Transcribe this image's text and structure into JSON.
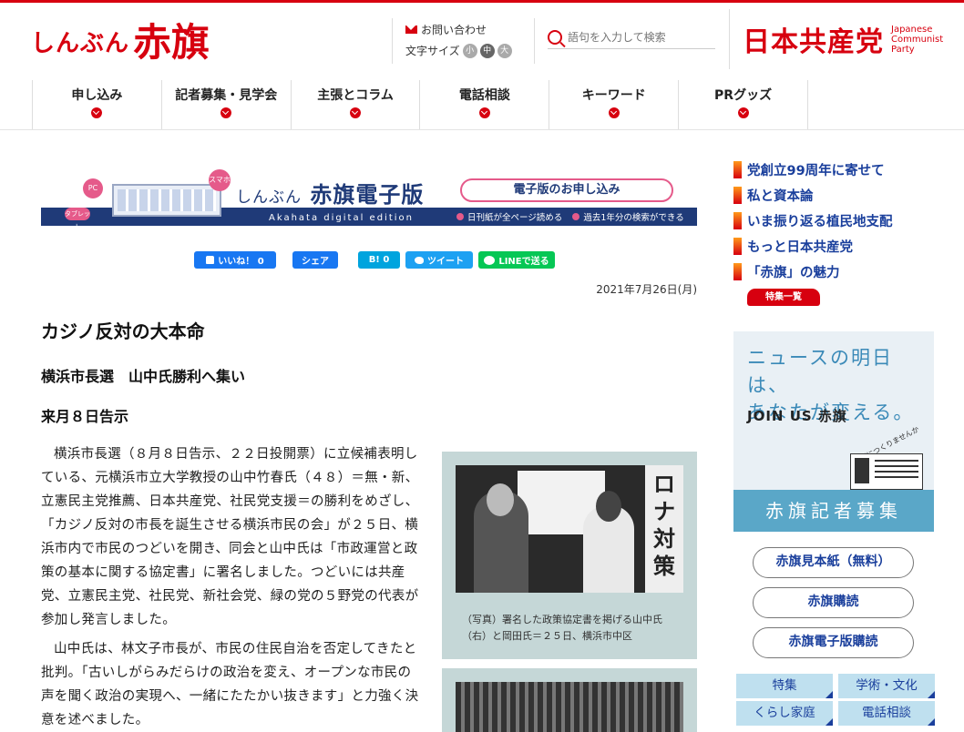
{
  "header": {
    "logo_small": "しんぶん",
    "logo_large": "赤旗",
    "contact_label": "お問い合わせ",
    "font_size_label": "文字サイズ",
    "font_sizes": [
      "小",
      "中",
      "大"
    ],
    "search_placeholder": "語句を入力して検索",
    "party_name": "日本共産党",
    "party_en": [
      "Japanese",
      "Communist",
      "Party"
    ]
  },
  "nav": {
    "items": [
      "申し込み",
      "記者募集・見学会",
      "主張とコラム",
      "電話相談",
      "キーワード",
      "PRグッズ"
    ]
  },
  "banner": {
    "badge_pc": "PC",
    "badge_tablet": "タブレット",
    "badge_sp": "スマホ",
    "title_small": "しんぶん",
    "title_large": "赤旗電子版",
    "subtitle": "Akahata digital edition",
    "apply_label": "電子版のお申し込み",
    "feature1": "日刊紙が全ページ読める",
    "feature2": "過去1年分の検索ができる"
  },
  "share": {
    "fb_label": "いいね！ 0",
    "fb_share": "シェア",
    "hatena_label": "B! 0",
    "tweet_label": "ツイート",
    "line_label": "LINEで送る"
  },
  "article": {
    "date": "2021年7月26日(月)",
    "title": "カジノ反対の大本命",
    "subtitle": "横浜市長選　山中氏勝利へ集い",
    "subtitle2": "来月８日告示",
    "para1": "横浜市長選（８月８日告示、２２日投開票）に立候補表明している、元横浜市立大学教授の山中竹春氏（４８）＝無・新、立憲民主党推薦、日本共産党、社民党支援＝の勝利をめざし、「カジノ反対の市長を誕生させる横浜市民の会」が２５日、横浜市内で市民のつどいを開き、同会と山中氏は「市政運営と政策の基本に関する協定書」に署名しました。つどいには共産党、立憲民主党、社民党、新社会党、緑の党の５野党の代表が参加し発言しました。",
    "para2": "山中氏は、林文子市長が、市民の住民自治を否定してきたと批判。「古いしがらみだらけの政治を変え、オープンな市民の声を聞く政治の実現へ、一緒にたたかい抜きます」と力強く決意を述べました。",
    "photo_sign": "ロナ対策",
    "caption": "（写真）署名した政策協定書を掲げる山中氏（右）と岡田氏＝２５日、横浜市中区"
  },
  "sidebar": {
    "links": [
      "党創立99周年に寄せて",
      "私と資本論",
      "いま振り返る植民地支配",
      "もっと日本共産党",
      "「赤旗」の魅力"
    ],
    "feature_list_label": "特集一覧",
    "ad_copy_line1": "ニュースの明日は、",
    "ad_copy_line2": "あなたが変える。",
    "ad_join": "JOIN US 赤旗",
    "ad_tag": "一緒につくりませんか",
    "ad_recruit": "赤旗記者募集",
    "pills": [
      "赤旗見本紙（無料）",
      "赤旗購読",
      "赤旗電子版購読"
    ],
    "tiles": [
      "特集",
      "学術・文化",
      "くらし家庭",
      "電話相談"
    ]
  },
  "colors": {
    "brand_red": "#d7000f",
    "link_blue": "#1a3f9c",
    "banner_navy": "#1f3a78"
  }
}
